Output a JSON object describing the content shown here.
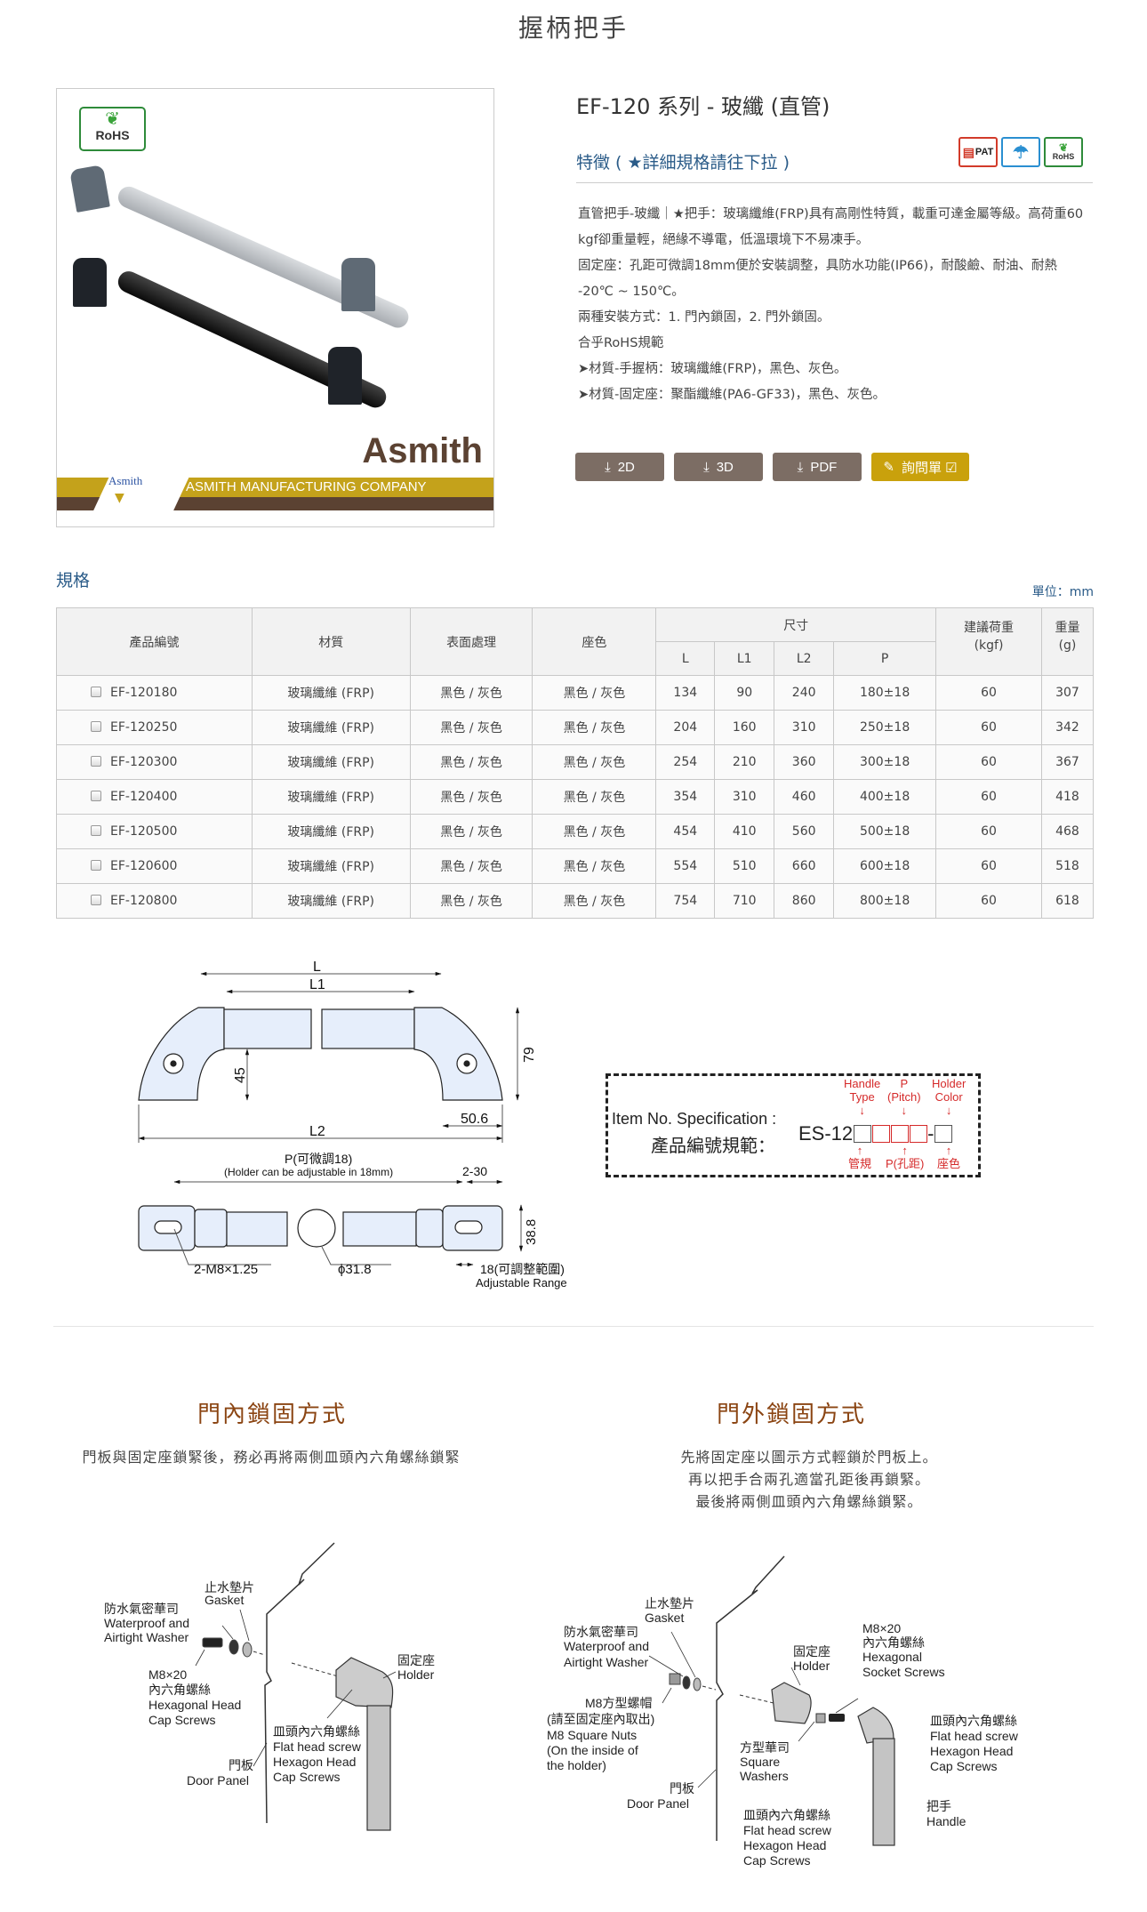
{
  "page": {
    "title": "握柄把手"
  },
  "product_image": {
    "rohs_badge": "RoHS",
    "brand": "Asmith",
    "banner_logo": "Asmith",
    "banner_company": "ASMITH MANUFACTURING COMPANY"
  },
  "product": {
    "series_title": "EF-120 系列 - 玻纖 (直管)",
    "features_heading": "特徵 ( ★詳細規格請往下拉 )",
    "cert_icons": [
      {
        "icon": "patent-icon",
        "label": "PAT",
        "color": "#d23b2a"
      },
      {
        "icon": "waterproof-umbrella-icon",
        "label": "☂",
        "color": "#2a8fd1"
      },
      {
        "icon": "rohs-icon",
        "label": "RoHS",
        "color": "#2e8b3a"
      }
    ],
    "features": [
      "直管把手-玻纖｜★把手：玻璃纖維(FRP)具有高剛性特質，載重可達金屬等級。高荷重60 kgf卻重量輕，絕緣不導電，低溫環境下不易凍手。",
      "固定座：孔距可微調18mm便於安裝調整，具防水功能(IP66)，耐酸鹼、耐油、耐熱 -20℃ ~ 150℃。",
      "兩種安裝方式：1. 門內鎖固，2. 門外鎖固。",
      "合乎RoHS規範",
      "➤材質-手握柄：玻璃纖維(FRP)，黑色、灰色。",
      "➤材質-固定座：聚酯纖維(PA6-GF33)，黑色、灰色。"
    ],
    "buttons": [
      {
        "label": "2D",
        "icon": "download-icon"
      },
      {
        "label": "3D",
        "icon": "download-icon"
      },
      {
        "label": "PDF",
        "icon": "download-icon"
      },
      {
        "label": "詢問單 ☑",
        "icon": "edit-icon"
      }
    ],
    "colors": {
      "button": "#7c6d64",
      "inquiry": "#c9a10c",
      "heading": "#2a5b88",
      "section_title": "#8b4513"
    }
  },
  "spec": {
    "heading": "規格",
    "unit": "單位：mm",
    "headers": {
      "code": "產品編號",
      "material": "材質",
      "surface": "表面處理",
      "holder_color": "座色",
      "dimension": "尺寸",
      "L": "L",
      "L1": "L1",
      "L2": "L2",
      "P": "P",
      "load": "建議荷重\n(kgf)",
      "load_l1": "建議荷重",
      "load_l2": "(kgf)",
      "weight_l1": "重量",
      "weight_l2": "(g)"
    },
    "rows": [
      {
        "code": "EF-120180",
        "material": "玻璃纖維 (FRP)",
        "surface": "黑色 / 灰色",
        "holder_color": "黑色 / 灰色",
        "L": "134",
        "L1": "90",
        "L2": "240",
        "P": "180±18",
        "load": "60",
        "weight": "307"
      },
      {
        "code": "EF-120250",
        "material": "玻璃纖維 (FRP)",
        "surface": "黑色 / 灰色",
        "holder_color": "黑色 / 灰色",
        "L": "204",
        "L1": "160",
        "L2": "310",
        "P": "250±18",
        "load": "60",
        "weight": "342"
      },
      {
        "code": "EF-120300",
        "material": "玻璃纖維 (FRP)",
        "surface": "黑色 / 灰色",
        "holder_color": "黑色 / 灰色",
        "L": "254",
        "L1": "210",
        "L2": "360",
        "P": "300±18",
        "load": "60",
        "weight": "367"
      },
      {
        "code": "EF-120400",
        "material": "玻璃纖維 (FRP)",
        "surface": "黑色 / 灰色",
        "holder_color": "黑色 / 灰色",
        "L": "354",
        "L1": "310",
        "L2": "460",
        "P": "400±18",
        "load": "60",
        "weight": "418"
      },
      {
        "code": "EF-120500",
        "material": "玻璃纖維 (FRP)",
        "surface": "黑色 / 灰色",
        "holder_color": "黑色 / 灰色",
        "L": "454",
        "L1": "410",
        "L2": "560",
        "P": "500±18",
        "load": "60",
        "weight": "468"
      },
      {
        "code": "EF-120600",
        "material": "玻璃纖維 (FRP)",
        "surface": "黑色 / 灰色",
        "holder_color": "黑色 / 灰色",
        "L": "554",
        "L1": "510",
        "L2": "660",
        "P": "600±18",
        "load": "60",
        "weight": "518"
      },
      {
        "code": "EF-120800",
        "material": "玻璃纖維 (FRP)",
        "surface": "黑色 / 灰色",
        "holder_color": "黑色 / 灰色",
        "L": "754",
        "L1": "710",
        "L2": "860",
        "P": "800±18",
        "load": "60",
        "weight": "618"
      }
    ]
  },
  "drawing": {
    "L": "L",
    "L1": "L1",
    "L2": "L2",
    "h45": "45",
    "h79": "79",
    "w50_6": "50.6",
    "p_label": "P(可微調18)",
    "p_note": "(Holder can be adjustable in 18mm)",
    "d2_30": "2-30",
    "d38_8": "38.8",
    "thread": "2-M8×1.25",
    "diameter": "ϕ31.8",
    "adj_range": "18(可調整範圍)",
    "adj_range_en": "Adjustable Range"
  },
  "item_spec": {
    "label_en": "Item No. Specification :",
    "label_zh": "產品編號規範：",
    "prefix": "ES-12",
    "sep": "-",
    "top_labels": [
      "Handle\nType",
      "P\n(Pitch)",
      "Holder\nColor"
    ],
    "top_l1": [
      "Handle",
      "P",
      "Holder"
    ],
    "top_l2": [
      "Type",
      "(Pitch)",
      "Color"
    ],
    "bottom_labels": [
      "管規",
      "P(孔距)",
      "座色"
    ]
  },
  "mount_inside": {
    "title": "門內鎖固方式",
    "desc": [
      "門板與固定座鎖緊後，務必再將兩側皿頭內六角螺絲鎖緊"
    ],
    "labels": {
      "gasket_zh": "止水墊片",
      "gasket_en": "Gasket",
      "washer_zh": "防水氣密華司",
      "washer_en1": "Waterproof and",
      "washer_en2": "Airtight Washer",
      "screw_l1": "M8×20",
      "screw_l2": "內六角螺絲",
      "screw_l3": "Hexagonal Head",
      "screw_l4": "Cap Screws",
      "holder_zh": "固定座",
      "holder_en": "Holder",
      "flat_zh": "皿頭內六角螺絲",
      "flat_en1": "Flat head screw",
      "flat_en2": "Hexagon Head",
      "flat_en3": "Cap Screws",
      "panel_zh": "門板",
      "panel_en": "Door Panel"
    }
  },
  "mount_outside": {
    "title": "門外鎖固方式",
    "desc": [
      "先將固定座以圖示方式輕鎖於門板上。",
      "再以把手合兩孔適當孔距後再鎖緊。",
      "最後將兩側皿頭內六角螺絲鎖緊。"
    ],
    "labels": {
      "gasket_zh": "止水墊片",
      "gasket_en": "Gasket",
      "washer_zh": "防水氣密華司",
      "washer_en1": "Waterproof and",
      "washer_en2": "Airtight Washer",
      "nut_l1": "M8方型螺帽",
      "nut_l2": "(請至固定座內取出)",
      "nut_l3": "M8 Square Nuts",
      "nut_l4": "(On the inside of",
      "nut_l5": "the holder)",
      "panel_zh": "門板",
      "panel_en": "Door Panel",
      "holder_zh": "固定座",
      "holder_en": "Holder",
      "sqw_zh": "方型華司",
      "sqw_en1": "Square",
      "sqw_en2": "Washers",
      "socket_l1": "M8×20",
      "socket_l2": "內六角螺絲",
      "socket_l3": "Hexagonal",
      "socket_l4": "Socket Screws",
      "flat_zh": "皿頭內六角螺絲",
      "flat_en1": "Flat head screw",
      "flat_en2": "Hexagon Head",
      "flat_en3": "Cap Screws",
      "handle_zh": "把手",
      "handle_en": "Handle"
    }
  }
}
